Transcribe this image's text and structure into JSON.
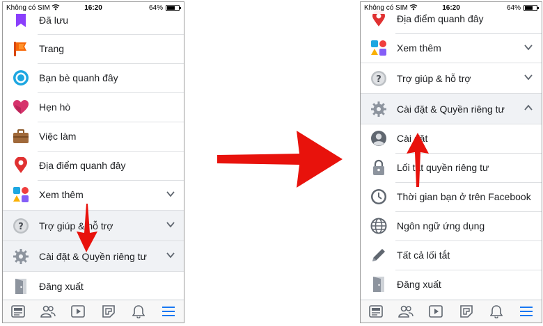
{
  "status": {
    "carrier": "Không có SIM",
    "time": "16:20",
    "battery": "64%"
  },
  "left_menu": [
    {
      "name": "saved",
      "label": "Đã lưu",
      "icon": "bookmark-icon"
    },
    {
      "name": "pages",
      "label": "Trang",
      "icon": "flag-icon"
    },
    {
      "name": "nearby-friends",
      "label": "Bạn bè quanh đây",
      "icon": "nearby-friends-icon"
    },
    {
      "name": "dating",
      "label": "Hẹn hò",
      "icon": "heart-icon"
    },
    {
      "name": "jobs",
      "label": "Việc làm",
      "icon": "briefcase-icon"
    },
    {
      "name": "nearby-places",
      "label": "Địa điểm quanh đây",
      "icon": "location-pin-icon"
    },
    {
      "name": "see-more",
      "label": "Xem thêm",
      "icon": "shapes-icon"
    },
    {
      "name": "help-support",
      "label": "Trợ giúp & hỗ trợ",
      "icon": "question-icon"
    },
    {
      "name": "settings-privacy",
      "label": "Cài đặt & Quyền riêng tư",
      "icon": "gear-icon"
    },
    {
      "name": "logout",
      "label": "Đăng xuất",
      "icon": "door-icon"
    }
  ],
  "right_menu": [
    {
      "name": "nearby-places",
      "label": "Địa điểm quanh đây",
      "icon": "location-pin-icon"
    },
    {
      "name": "see-more",
      "label": "Xem thêm",
      "icon": "shapes-icon"
    },
    {
      "name": "help-support",
      "label": "Trợ giúp & hỗ trợ",
      "icon": "question-icon"
    },
    {
      "name": "settings-privacy",
      "label": "Cài đặt & Quyền riêng tư",
      "icon": "gear-icon"
    },
    {
      "name": "settings",
      "label": "Cài đặt",
      "icon": "user-circle-icon"
    },
    {
      "name": "privacy-shortcuts",
      "label": "Lối tắt quyền riêng tư",
      "icon": "lock-icon"
    },
    {
      "name": "time-on-facebook",
      "label": "Thời gian bạn ở trên Facebook",
      "icon": "clock-icon"
    },
    {
      "name": "app-language",
      "label": "Ngôn ngữ ứng dụng",
      "icon": "globe-icon"
    },
    {
      "name": "all-shortcuts",
      "label": "Tất cả lối tắt",
      "icon": "pencil-icon"
    },
    {
      "name": "logout",
      "label": "Đăng xuất",
      "icon": "door-icon"
    }
  ],
  "tabs": [
    "news-feed-icon",
    "friends-icon",
    "watch-icon",
    "pages-icon",
    "notifications-icon",
    "menu-icon"
  ],
  "colors": {
    "accent": "#1877f2",
    "arrow": "#e8120c",
    "section_gray": "#f0f2f5"
  }
}
